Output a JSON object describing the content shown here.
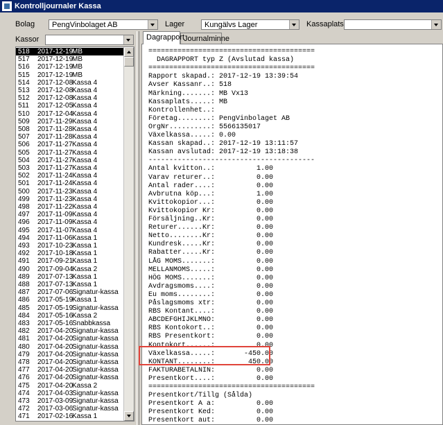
{
  "window": {
    "title": "Kontrolljournaler Kassa"
  },
  "filters": {
    "bolag_label": "Bolag",
    "bolag_value": "PengVinbolaget AB",
    "lager_label": "Lager",
    "lager_value": "Kungälvs Lager",
    "kassaplats_label": "Kassaplats",
    "kassaplats_value": "",
    "kassor_label": "Kassor",
    "kassor_value": ""
  },
  "kassor_list": [
    {
      "id": "518",
      "date": "2017-12-19",
      "name": "MB"
    },
    {
      "id": "517",
      "date": "2017-12-19",
      "name": "MB"
    },
    {
      "id": "516",
      "date": "2017-12-19",
      "name": "MB"
    },
    {
      "id": "515",
      "date": "2017-12-19",
      "name": "MB"
    },
    {
      "id": "514",
      "date": "2017-12-08",
      "name": "Kassa 4"
    },
    {
      "id": "513",
      "date": "2017-12-08",
      "name": "Kassa 4"
    },
    {
      "id": "512",
      "date": "2017-12-08",
      "name": "Kassa 4"
    },
    {
      "id": "511",
      "date": "2017-12-05",
      "name": "Kassa 4"
    },
    {
      "id": "510",
      "date": "2017-12-04",
      "name": "Kassa 4"
    },
    {
      "id": "509",
      "date": "2017-11-29",
      "name": "Kassa 4"
    },
    {
      "id": "508",
      "date": "2017-11-28",
      "name": "Kassa 4"
    },
    {
      "id": "507",
      "date": "2017-11-28",
      "name": "Kassa 4"
    },
    {
      "id": "506",
      "date": "2017-11-27",
      "name": "Kassa 4"
    },
    {
      "id": "505",
      "date": "2017-11-27",
      "name": "Kassa 4"
    },
    {
      "id": "504",
      "date": "2017-11-27",
      "name": "Kassa 4"
    },
    {
      "id": "503",
      "date": "2017-11-27",
      "name": "Kassa 4"
    },
    {
      "id": "502",
      "date": "2017-11-24",
      "name": "Kassa 4"
    },
    {
      "id": "501",
      "date": "2017-11-24",
      "name": "Kassa 4"
    },
    {
      "id": "500",
      "date": "2017-11-23",
      "name": "Kassa 4"
    },
    {
      "id": "499",
      "date": "2017-11-23",
      "name": "Kassa 4"
    },
    {
      "id": "498",
      "date": "2017-11-22",
      "name": "Kassa 4"
    },
    {
      "id": "497",
      "date": "2017-11-09",
      "name": "Kassa 4"
    },
    {
      "id": "496",
      "date": "2017-11-09",
      "name": "Kassa 4"
    },
    {
      "id": "495",
      "date": "2017-11-07",
      "name": "Kassa 4"
    },
    {
      "id": "494",
      "date": "2017-11-06",
      "name": "Kassa 1"
    },
    {
      "id": "493",
      "date": "2017-10-23",
      "name": "Kassa 1"
    },
    {
      "id": "492",
      "date": "2017-10-18",
      "name": "Kassa 1"
    },
    {
      "id": "491",
      "date": "2017-09-21",
      "name": "Kassa 1"
    },
    {
      "id": "490",
      "date": "2017-09-04",
      "name": "Kassa 2"
    },
    {
      "id": "489",
      "date": "2017-07-13",
      "name": "Kassa 1"
    },
    {
      "id": "488",
      "date": "2017-07-13",
      "name": "Kassa 1"
    },
    {
      "id": "487",
      "date": "2017-07-06",
      "name": "Signatur-kassa"
    },
    {
      "id": "486",
      "date": "2017-05-19",
      "name": "Kassa 1"
    },
    {
      "id": "485",
      "date": "2017-05-19",
      "name": "Signatur-kassa"
    },
    {
      "id": "484",
      "date": "2017-05-16",
      "name": "Kassa 2"
    },
    {
      "id": "483",
      "date": "2017-05-16",
      "name": "Snabbkassa"
    },
    {
      "id": "482",
      "date": "2017-04-20",
      "name": "Signatur-kassa"
    },
    {
      "id": "481",
      "date": "2017-04-20",
      "name": "Signatur-kassa"
    },
    {
      "id": "480",
      "date": "2017-04-20",
      "name": "Signatur-kassa"
    },
    {
      "id": "479",
      "date": "2017-04-20",
      "name": "Signatur-kassa"
    },
    {
      "id": "478",
      "date": "2017-04-20",
      "name": "Signatur-kassa"
    },
    {
      "id": "477",
      "date": "2017-04-20",
      "name": "Signatur-kassa"
    },
    {
      "id": "476",
      "date": "2017-04-20",
      "name": "Signatur-kassa"
    },
    {
      "id": "475",
      "date": "2017-04-20",
      "name": "Kassa 2"
    },
    {
      "id": "474",
      "date": "2017-04-03",
      "name": "Signatur-kassa"
    },
    {
      "id": "473",
      "date": "2017-03-09",
      "name": "Signatur-kassa"
    },
    {
      "id": "472",
      "date": "2017-03-06",
      "name": "Signatur-kassa"
    },
    {
      "id": "471",
      "date": "2017-02-16",
      "name": "Kassa 1"
    }
  ],
  "tabs": [
    "Dagrapport",
    "Journalminne"
  ],
  "report_lines": [
    "========================================",
    "  DAGRAPPORT typ Z (Avslutad kassa)",
    "========================================",
    "Rapport skapad.: 2017-12-19 13:39:54",
    "Avser Kassanr..: 518",
    "Märkning.......: MB Vx13",
    "Kassaplats.....: MB",
    "Kontrollenhet..:",
    "Företag........: PengVinbolaget AB",
    "OrgNr..........: 5566135017",
    "Växelkassa.....: 0.00",
    "Kassan skapad..: 2017-12-19 13:11:57",
    "Kassan avslutad: 2017-12-19 13:18:38",
    "----------------------------------------",
    "Antal kvitton..:          1.00",
    "Varav returer..:          0.00",
    "Antal rader....:          0.00",
    "Avbrutna köp...:          1.00",
    "Kvittokopior...:          0.00",
    "Kvittokopior Kr:          0.00",
    "Försäljning..Kr:          0.00",
    "Returer......Kr:          0.00",
    "Netto........Kr:          0.00",
    "Kundresk.....Kr:          0.00",
    "Rabatter.....Kr:          0.00",
    "LÅG MOMS.......:          0.00",
    "MELLANMOMS.....:          0.00",
    "HÖG MOMS.......:          0.00",
    "Avdragsmoms....:          0.00",
    "Eu moms........:          0.00",
    "Påslagsmoms xtr:          0.00",
    "RBS Kontant....:          0.00",
    "ABCDEFGHIJKLMNO:          0.00",
    "RBS Kontokort..:          0.00",
    "RBS Presentkort:          0.00",
    "Kontokort......:          0.00",
    "Växelkassa.....:       -450.00",
    "KONTANT........:        450.00",
    "FAKTURABETALNIN:          0.00",
    "Presentkort....:          0.00",
    "========================================",
    "Presentkort/Tillg (Sålda)",
    "Presentkort A a:          0.00",
    "Presentkort Ked:          0.00",
    "Presentkort aut:          0.00"
  ],
  "colors": {
    "titlebar": "#0a246a",
    "highlight_box": "#e0433a",
    "selection": "#000000"
  }
}
